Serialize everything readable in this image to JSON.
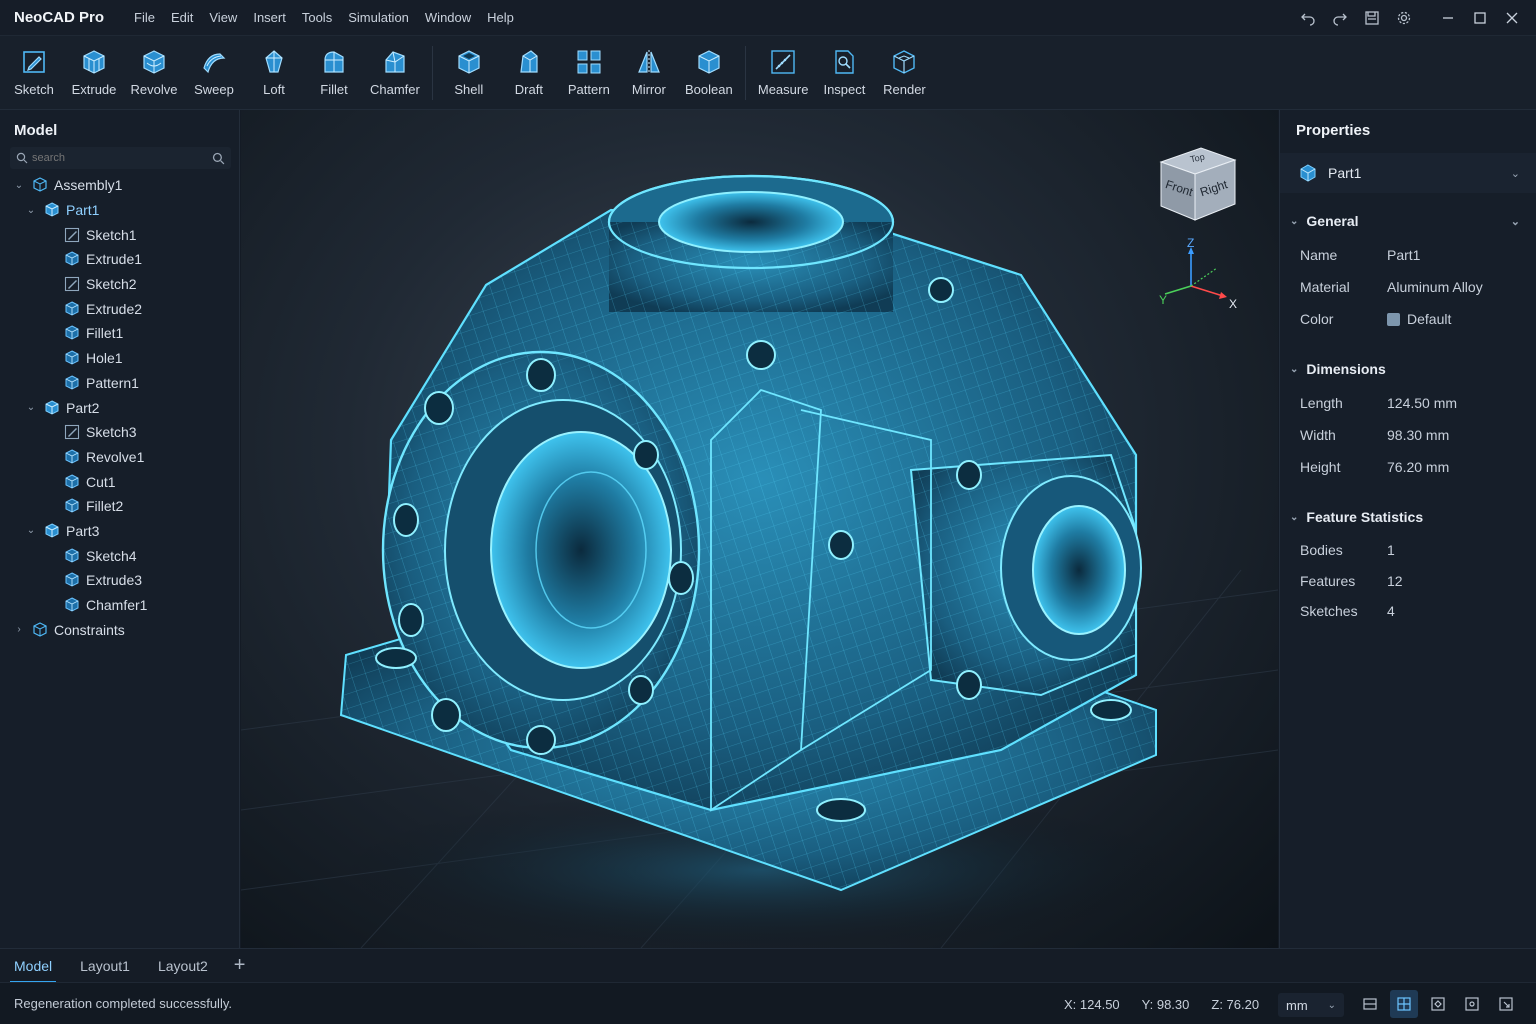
{
  "app": {
    "title": "NeoCAD Pro"
  },
  "menu": [
    "File",
    "Edit",
    "View",
    "Insert",
    "Tools",
    "Simulation",
    "Window",
    "Help"
  ],
  "window_controls": [
    "undo-icon",
    "redo-icon",
    "save-icon",
    "settings-icon",
    "minimize-icon",
    "maximize-icon",
    "close-icon"
  ],
  "ribbon": {
    "groups": [
      [
        "Sketch",
        "Extrude",
        "Revolve",
        "Sweep",
        "Loft",
        "Fillet",
        "Chamfer"
      ],
      [
        "Shell",
        "Draft",
        "Pattern",
        "Mirror",
        "Boolean"
      ],
      [
        "Measure",
        "Inspect",
        "Render"
      ]
    ]
  },
  "left_panel": {
    "title": "Model",
    "search_placeholder": "search",
    "tree": [
      {
        "label": "Assembly1",
        "level": 0,
        "expanded": true,
        "icon": "assembly-icon"
      },
      {
        "label": "Part1",
        "level": 1,
        "expanded": true,
        "icon": "part-icon",
        "selected": true
      },
      {
        "label": "Sketch1",
        "level": 2,
        "icon": "sketch-icon"
      },
      {
        "label": "Extrude1",
        "level": 2,
        "icon": "feature-icon"
      },
      {
        "label": "Sketch2",
        "level": 2,
        "icon": "sketch-icon"
      },
      {
        "label": "Extrude2",
        "level": 2,
        "icon": "feature-icon"
      },
      {
        "label": "Fillet1",
        "level": 2,
        "icon": "feature-icon"
      },
      {
        "label": "Hole1",
        "level": 2,
        "icon": "feature-icon"
      },
      {
        "label": "Pattern1",
        "level": 2,
        "icon": "feature-icon"
      },
      {
        "label": "Part2",
        "level": 1,
        "expanded": true,
        "icon": "part-icon"
      },
      {
        "label": "Sketch3",
        "level": 2,
        "icon": "sketch-icon"
      },
      {
        "label": "Revolve1",
        "level": 2,
        "icon": "feature-icon"
      },
      {
        "label": "Cut1",
        "level": 2,
        "icon": "feature-icon"
      },
      {
        "label": "Fillet2",
        "level": 2,
        "icon": "feature-icon"
      },
      {
        "label": "Part3",
        "level": 1,
        "expanded": true,
        "icon": "part-icon"
      },
      {
        "label": "Sketch4",
        "level": 2,
        "icon": "feature-icon"
      },
      {
        "label": "Extrude3",
        "level": 2,
        "icon": "feature-icon"
      },
      {
        "label": "Chamfer1",
        "level": 2,
        "icon": "feature-icon"
      },
      {
        "label": "Constraints",
        "level": 0,
        "expanded": false,
        "icon": "constraints-icon"
      }
    ]
  },
  "viewcube": {
    "top": "Top",
    "front": "Front",
    "right": "Right"
  },
  "triad": {
    "x": "X",
    "y": "Y",
    "z": "Z"
  },
  "properties": {
    "title": "Properties",
    "selected_part": "Part1",
    "general": {
      "title": "General",
      "rows": [
        {
          "key": "Name",
          "value": "Part1"
        },
        {
          "key": "Material",
          "value": "Aluminum Alloy"
        },
        {
          "key": "Color",
          "value": "Default"
        }
      ]
    },
    "dimensions": {
      "title": "Dimensions",
      "rows": [
        {
          "key": "Length",
          "value": "124.50 mm"
        },
        {
          "key": "Width",
          "value": "98.30 mm"
        },
        {
          "key": "Height",
          "value": "76.20 mm"
        }
      ]
    },
    "stats": {
      "title": "Feature Statistics",
      "rows": [
        {
          "key": "Bodies",
          "value": "1"
        },
        {
          "key": "Features",
          "value": "12"
        },
        {
          "key": "Sketches",
          "value": "4"
        }
      ]
    }
  },
  "tabs": {
    "items": [
      "Model",
      "Layout1",
      "Layout2"
    ],
    "active": 0
  },
  "status": {
    "message": "Regeneration completed successfully.",
    "x": "X: 124.50",
    "y": "Y: 98.30",
    "z": "Z: 76.20",
    "unit": "mm"
  },
  "colors": {
    "accent": "#35a5f0",
    "wire": "#3fd0ff",
    "model_fill": "#1d6f93"
  }
}
